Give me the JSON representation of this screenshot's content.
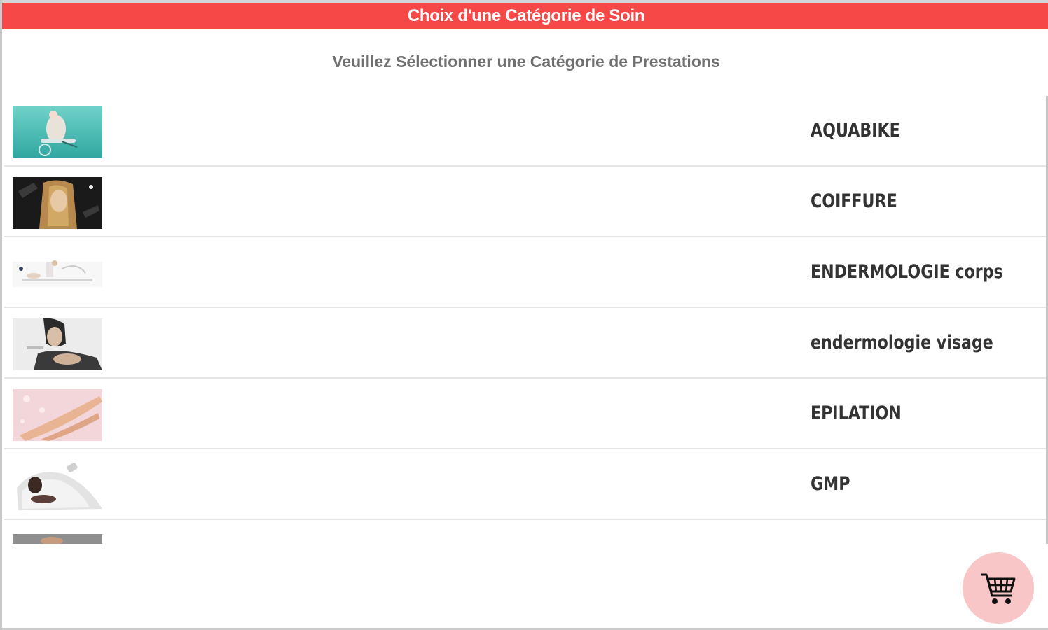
{
  "header": {
    "title": "Choix d'une Catégorie de Soin"
  },
  "subtitle": "Veuillez Sélectionner une Catégorie de Prestations",
  "categories": [
    {
      "label": "AQUABIKE"
    },
    {
      "label": "COIFFURE"
    },
    {
      "label": "ENDERMOLOGIE corps"
    },
    {
      "label": "endermologie visage"
    },
    {
      "label": "EPILATION"
    },
    {
      "label": "GMP"
    }
  ],
  "cart_button": {
    "icon": "shopping-cart-icon"
  },
  "colors": {
    "title_bar": "#f74848",
    "cart_fab": "#f8c6c6",
    "label_text": "#333333",
    "subtitle_text": "#707070"
  }
}
